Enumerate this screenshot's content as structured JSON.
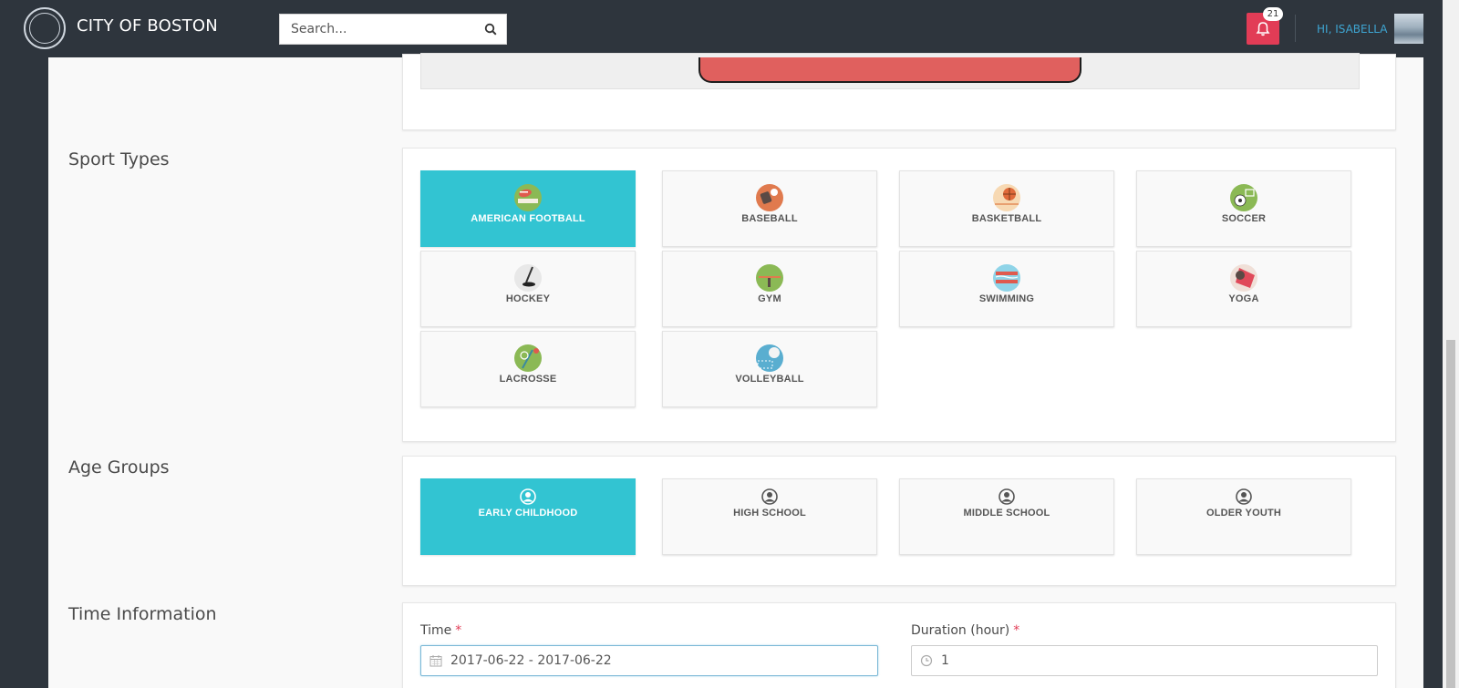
{
  "header": {
    "brand": "CITY OF BOSTON",
    "search_placeholder": "Search...",
    "notification_count": "21",
    "greeting": "HI, ISABELLA"
  },
  "sections": {
    "sport_types_title": "Sport Types",
    "age_groups_title": "Age Groups",
    "time_info_title": "Time Information"
  },
  "sport_types": [
    {
      "label": "AMERICAN FOOTBALL",
      "icon": "american-football-icon",
      "selected": true
    },
    {
      "label": "BASEBALL",
      "icon": "baseball-icon",
      "selected": false
    },
    {
      "label": "BASKETBALL",
      "icon": "basketball-icon",
      "selected": false
    },
    {
      "label": "SOCCER",
      "icon": "soccer-icon",
      "selected": false
    },
    {
      "label": "HOCKEY",
      "icon": "hockey-icon",
      "selected": false
    },
    {
      "label": "GYM",
      "icon": "gym-icon",
      "selected": false
    },
    {
      "label": "SWIMMING",
      "icon": "swimming-icon",
      "selected": false
    },
    {
      "label": "YOGA",
      "icon": "yoga-icon",
      "selected": false
    },
    {
      "label": "LACROSSE",
      "icon": "lacrosse-icon",
      "selected": false
    },
    {
      "label": "VOLLEYBALL",
      "icon": "volleyball-icon",
      "selected": false
    }
  ],
  "age_groups": [
    {
      "label": "EARLY CHILDHOOD",
      "selected": true
    },
    {
      "label": "HIGH SCHOOL",
      "selected": false
    },
    {
      "label": "MIDDLE SCHOOL",
      "selected": false
    },
    {
      "label": "OLDER YOUTH",
      "selected": false
    }
  ],
  "time_info": {
    "time_label": "Time",
    "time_value": "2017-06-22 - 2017-06-22",
    "duration_label": "Duration (hour)",
    "duration_value": "1",
    "required_mark": "*"
  },
  "colors": {
    "accent": "#32c4d2",
    "topbar": "#2e353d",
    "alert": "#e23c56",
    "link": "#3ea6d3"
  }
}
